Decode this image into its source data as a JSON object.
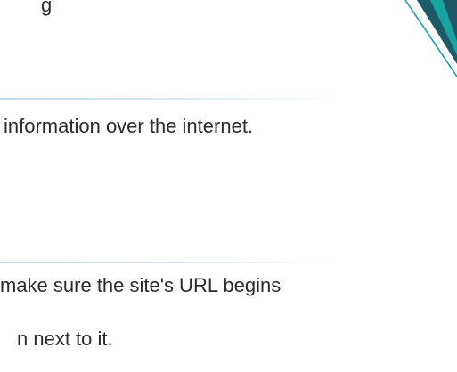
{
  "content": {
    "line1": "g",
    "line2": "information over the internet.",
    "line3": "make sure the site's URL begins",
    "line4": "n next to it."
  },
  "colors": {
    "text": "#2b2b2b",
    "divider": "#bcd9ea",
    "accent_teal": "#1aa3a3",
    "accent_dark": "#1d5a66"
  },
  "icons": {
    "corner": "decorative-chevron-graphic"
  }
}
